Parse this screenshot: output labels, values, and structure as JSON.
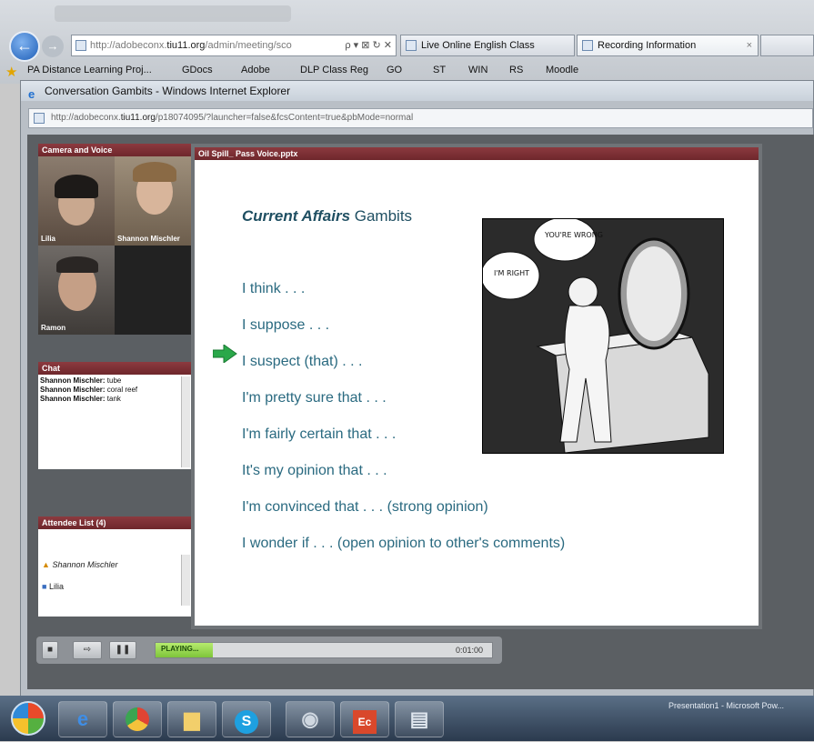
{
  "browser": {
    "address_host": "http://adobeconx.",
    "address_bold": "tiu11.org",
    "address_rest": "/admin/meeting/sco",
    "address_controls": "ρ ▾ ⊠ ↻ ✕",
    "tabs": [
      {
        "label": "Live Online English Class"
      },
      {
        "label": "Recording Information"
      }
    ],
    "tab_close": "×",
    "favorites": [
      "PA Distance Learning Proj...",
      "GDocs",
      "Adobe",
      "DLP Class Reg",
      "GO",
      "ST",
      "WIN",
      "RS",
      "Moodle"
    ]
  },
  "popup": {
    "title": "Conversation Gambits - Windows Internet Explorer",
    "address_host": "http://adobeconx.",
    "address_bold": "tiu11.org",
    "address_rest": "/p18074095/?launcher=false&fcsContent=true&pbMode=normal"
  },
  "camera": {
    "header": "Camera and Voice",
    "people": [
      {
        "name": "Lilia"
      },
      {
        "name": "Shannon Mischler"
      },
      {
        "name": "Ramon"
      }
    ]
  },
  "chat": {
    "header": "Chat",
    "messages": [
      {
        "sender": "Shannon Mischler:",
        "text": "tube"
      },
      {
        "sender": "Shannon Mischler:",
        "text": "coral reef"
      },
      {
        "sender": "Shannon Mischler:",
        "text": "tank"
      }
    ]
  },
  "attendees": {
    "header": "Attendee List (4)",
    "list": [
      {
        "name": "Shannon Mischler"
      },
      {
        "name": "Lilia"
      }
    ]
  },
  "presentation": {
    "header": "Oil Spill_ Pass Voice.pptx",
    "title_bold": "Current Affairs",
    "title_rest": " Gambits",
    "gambits": [
      "I think . . .",
      "I suppose . . .",
      "I suspect (that) . . .",
      "I'm pretty sure that . . .",
      "I'm fairly certain that . . .",
      "It's my opinion that . . .",
      "I'm convinced that . . .  (strong opinion)",
      "I wonder if . . .  (open opinion to other's comments)"
    ],
    "cartoon_bubbles": {
      "mirror": "YOU'RE WRONG",
      "man": "I'M RIGHT"
    }
  },
  "playback": {
    "status": "PLAYING...",
    "time": "0:01:00",
    "progress": 0.17
  },
  "taskbar": {
    "right_text": "Presentation1 - Microsoft Pow..."
  }
}
